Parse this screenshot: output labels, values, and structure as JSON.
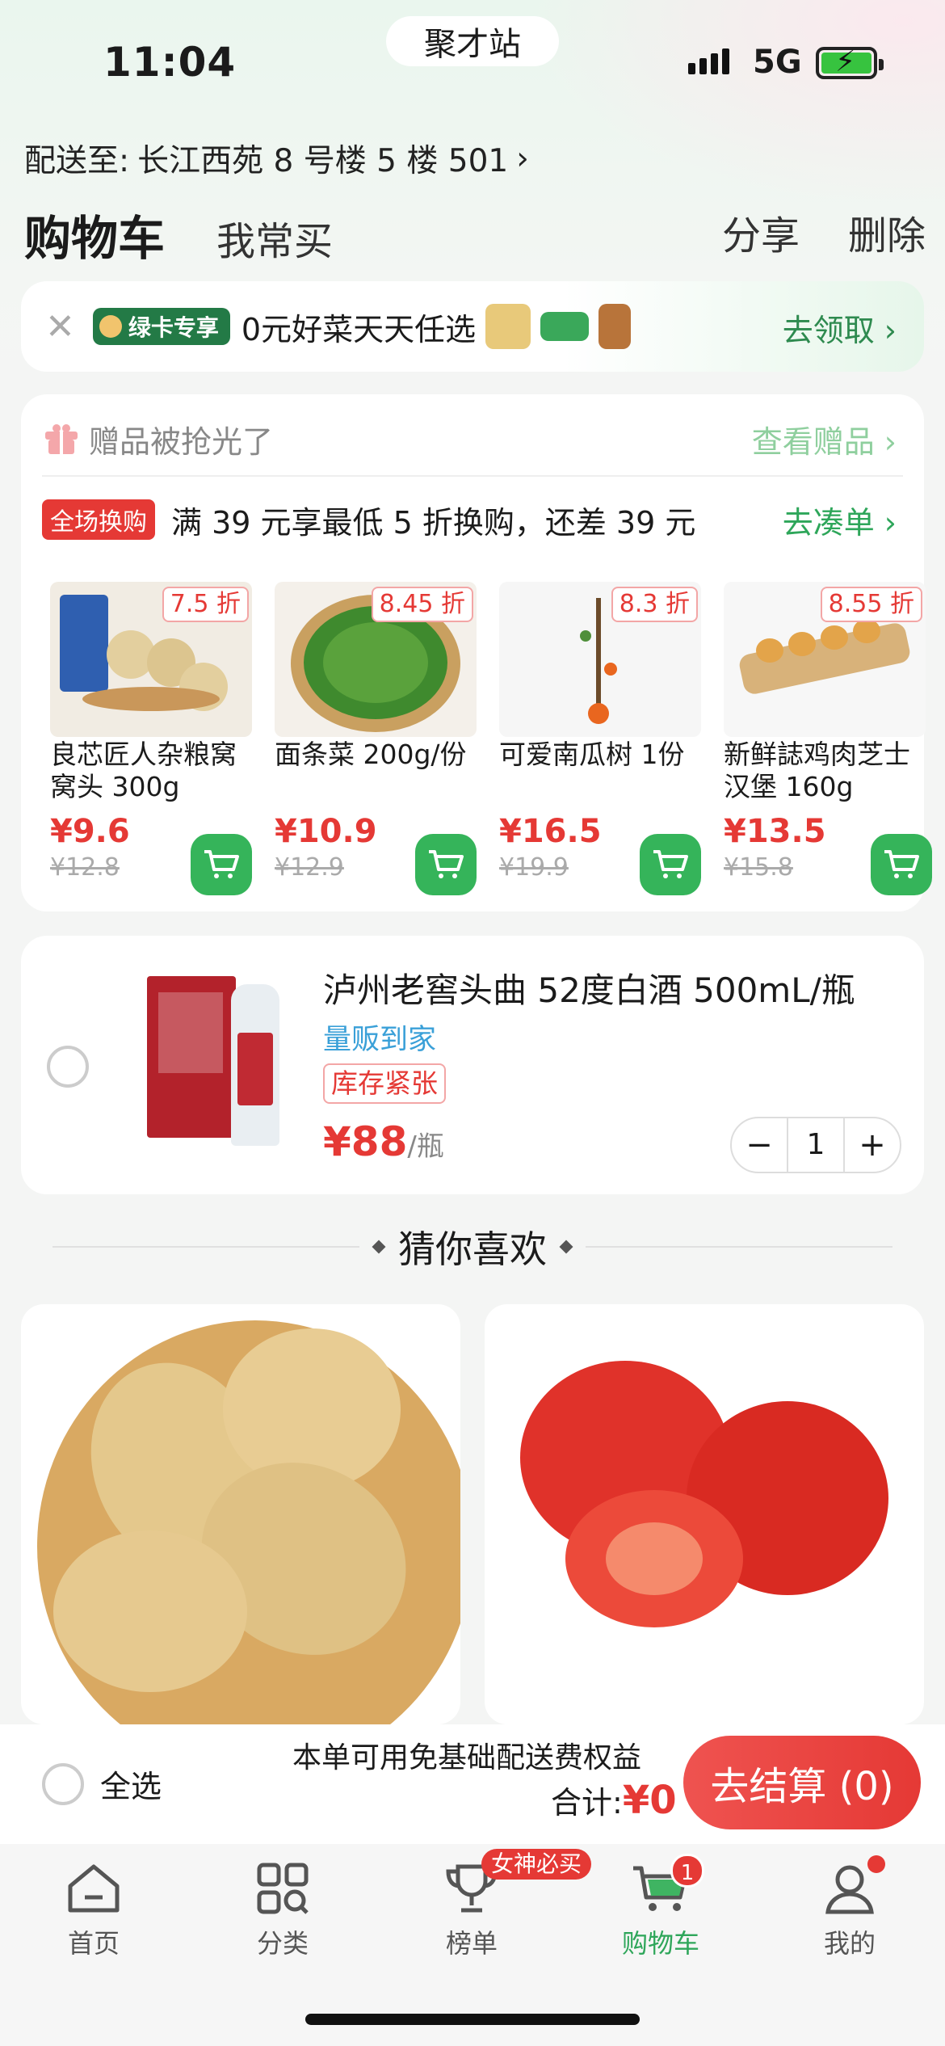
{
  "status": {
    "time": "11:04",
    "app_pill": "聚才站",
    "network": "5G"
  },
  "address": {
    "label": "配送至:",
    "value": "长江西苑 8 号楼 5 楼 501",
    "chevron": "›"
  },
  "tabs": {
    "active": "购物车",
    "other": "我常买"
  },
  "header_actions": {
    "share": "分享",
    "delete": "删除"
  },
  "promo": {
    "badge": "绿卡专享",
    "text": "0元好菜天天任选",
    "claim": "去领取 ›"
  },
  "gift": {
    "title": "赠品被抢光了",
    "view": "查看赠品 ›",
    "exchange_badge": "全场换购",
    "exchange_text": "满 39 元享最低 5 折换购，还差 39 元",
    "exchange_go": "去凑单 ›",
    "products": [
      {
        "discount": "7.5 折",
        "name": "良芯匠人杂粮窝窝头 300g",
        "price": "¥9.6",
        "orig": "¥12.8"
      },
      {
        "discount": "8.45 折",
        "name": "面条菜 200g/份",
        "price": "¥10.9",
        "orig": "¥12.9"
      },
      {
        "discount": "8.3 折",
        "name": "可爱南瓜树 1份",
        "price": "¥16.5",
        "orig": "¥19.9"
      },
      {
        "discount": "8.55 折",
        "name": "新鲜誌鸡肉芝士汉堡 160g",
        "price": "¥13.5",
        "orig": "¥15.8"
      }
    ]
  },
  "cart_item": {
    "name": "泸州老窖头曲 52度白酒 500mL/瓶",
    "tag1": "量贩到家",
    "tag2": "库存紧张",
    "price": "¥88",
    "unit": "/瓶",
    "qty": "1",
    "minus": "−",
    "plus": "+"
  },
  "guess": {
    "title": "猜你喜欢"
  },
  "bottom": {
    "select_all": "全选",
    "free_delivery": "本单可用免基础配送费权益",
    "total_label": "合计:",
    "total_value": "¥0",
    "checkout": "去结算 (0)"
  },
  "nav": {
    "home": "首页",
    "category": "分类",
    "rank": "榜单",
    "cart": "购物车",
    "me": "我的",
    "rank_badge": "女神必买",
    "cart_count": "1"
  },
  "colors": {
    "accent_green": "#35b45a",
    "price_red": "#e53935"
  }
}
